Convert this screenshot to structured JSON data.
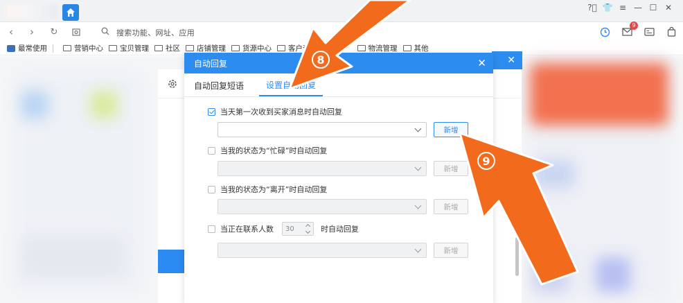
{
  "browser": {
    "address_placeholder": "搜索功能、网址、应用",
    "mail_badge": "9",
    "bookmarks": [
      "最常使用",
      "营销中心",
      "宝贝管理",
      "社区",
      "店铺管理",
      "货源中心",
      "客户运",
      "物流管理",
      "其他"
    ]
  },
  "dialog": {
    "title": "自动回复",
    "tabs": [
      {
        "label": "自动回复短语"
      },
      {
        "label": "设置自动回复"
      }
    ],
    "rows": [
      {
        "label": "当天第一次收到买家消息时自动回复",
        "checked": true,
        "add_label": "新增"
      },
      {
        "label": "当我的状态为“忙碌”时自动回复",
        "checked": false,
        "add_label": "新增"
      },
      {
        "label": "当我的状态为“离开”时自动回复",
        "checked": false,
        "add_label": "新增"
      },
      {
        "label_before": "当正在联系人数",
        "spin_value": "30",
        "label_after": "时自动回复",
        "checked": false,
        "add_label": "新增"
      }
    ]
  },
  "annotations": {
    "step_8": "8",
    "step_9": "9",
    "arrow_color": "#f26a1b"
  }
}
